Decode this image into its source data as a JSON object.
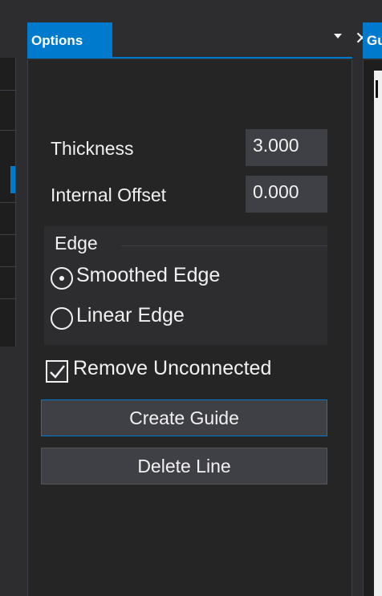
{
  "options_tab": {
    "title": "Options"
  },
  "right_tab": {
    "title": "Gu"
  },
  "fields": {
    "thickness": {
      "label": "Thickness",
      "value": "3.000"
    },
    "internal_offset": {
      "label": "Internal Offset",
      "value": "0.000"
    }
  },
  "edge_group": {
    "title": "Edge",
    "options": [
      {
        "label": "Smoothed Edge",
        "selected": true
      },
      {
        "label": "Linear Edge",
        "selected": false
      }
    ]
  },
  "remove_unconnected": {
    "label": "Remove Unconnected",
    "checked": true
  },
  "buttons": {
    "create_guide": "Create Guide",
    "delete_line": "Delete Line"
  },
  "colors": {
    "accent": "#007acc",
    "panel_bg": "#252526",
    "input_bg": "#3f3f46",
    "text": "#f1f1f1"
  }
}
